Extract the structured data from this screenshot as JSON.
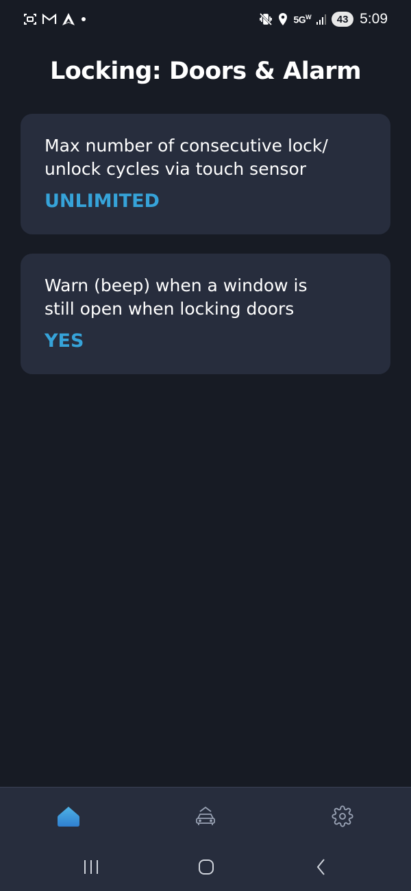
{
  "status_bar": {
    "left_icons": [
      "screenshot-icon",
      "gmail-icon",
      "navigation-app-icon",
      "notification-dot-icon"
    ],
    "right_icons": [
      "mute-vibrate-icon",
      "location-icon"
    ],
    "network_label": "5G",
    "network_sub": "W",
    "battery": "43",
    "time": "5:09"
  },
  "page": {
    "title": "Locking: Doors & Alarm"
  },
  "settings": [
    {
      "label": "Max number of consecutive lock/ unlock cycles via touch sensor",
      "label_line1": "Max number of consecutive lock/",
      "label_line2": "unlock cycles via touch sensor",
      "value": "UNLIMITED"
    },
    {
      "label": "Warn (beep) when a window is still open when locking doors",
      "label_line1": "Warn (beep) when a window is",
      "label_line2": "still open when locking doors",
      "value": "YES"
    }
  ],
  "bottom_nav": {
    "items": [
      {
        "icon": "home-icon",
        "active": true
      },
      {
        "icon": "car-icon",
        "active": false
      },
      {
        "icon": "gear-icon",
        "active": false
      }
    ]
  },
  "system_nav": {
    "buttons": [
      "recents-icon",
      "home-circle-icon",
      "back-icon"
    ]
  },
  "colors": {
    "background": "#171b24",
    "card": "#272d3d",
    "accent": "#36a3d9",
    "text": "#ffffff",
    "inactive_icon": "#9aa3b5"
  }
}
